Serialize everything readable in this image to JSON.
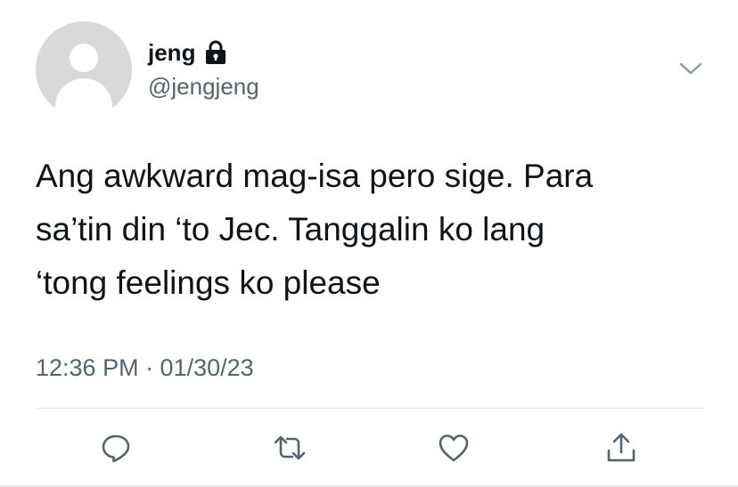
{
  "user": {
    "display_name": "jeng",
    "handle": "@jengjeng",
    "avatar_icon": "default-avatar-icon",
    "protected_icon": "lock-icon"
  },
  "tweet": {
    "text": "Ang awkward mag-isa pero sige. Para\nsa’tin din ‘to Jec. Tanggalin ko lang\n‘tong feelings ko please",
    "timestamp": "12:36 PM · 01/30/23"
  },
  "actions": [
    {
      "name": "reply",
      "icon": "reply-icon"
    },
    {
      "name": "retweet",
      "icon": "retweet-icon"
    },
    {
      "name": "like",
      "icon": "heart-icon"
    },
    {
      "name": "share",
      "icon": "share-icon"
    }
  ],
  "colors": {
    "text": "#0f1419",
    "secondary": "#536471",
    "icon": "#536471",
    "divider": "#e1e4e8"
  }
}
